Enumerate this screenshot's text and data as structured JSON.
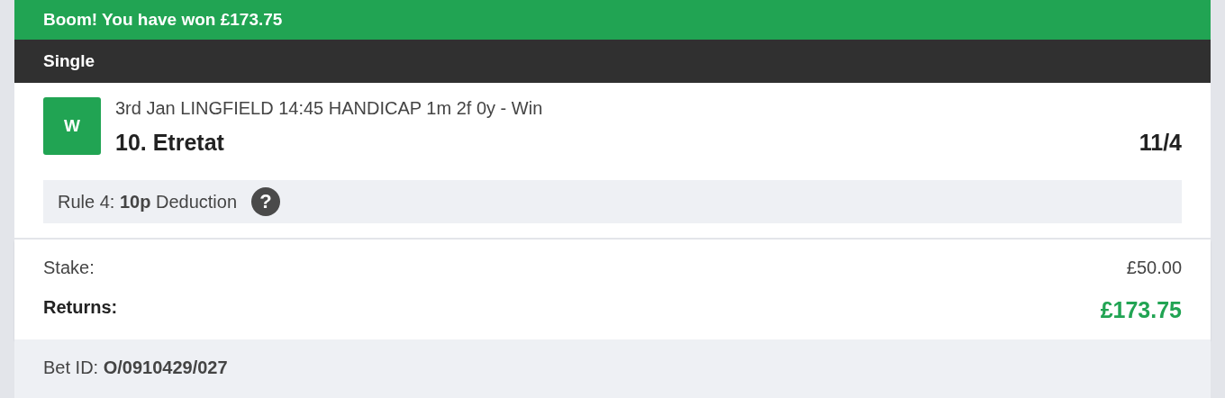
{
  "banner": {
    "text": "Boom! You have won £173.75"
  },
  "bet_type": "Single",
  "selection": {
    "won": true,
    "badge": "W",
    "event": "3rd Jan LINGFIELD 14:45 HANDICAP 1m 2f 0y - Win",
    "runner": "10. Etretat",
    "odds": "11/4"
  },
  "rule4": {
    "text": "Rule 4: **10p** Deduction",
    "help": "?"
  },
  "stake": {
    "label": "Stake:",
    "value": "£50.00"
  },
  "returns": {
    "label": "Returns:",
    "value": "£173.75"
  },
  "bet_id": {
    "label": "Bet ID:",
    "value": "O/0910429/027"
  }
}
